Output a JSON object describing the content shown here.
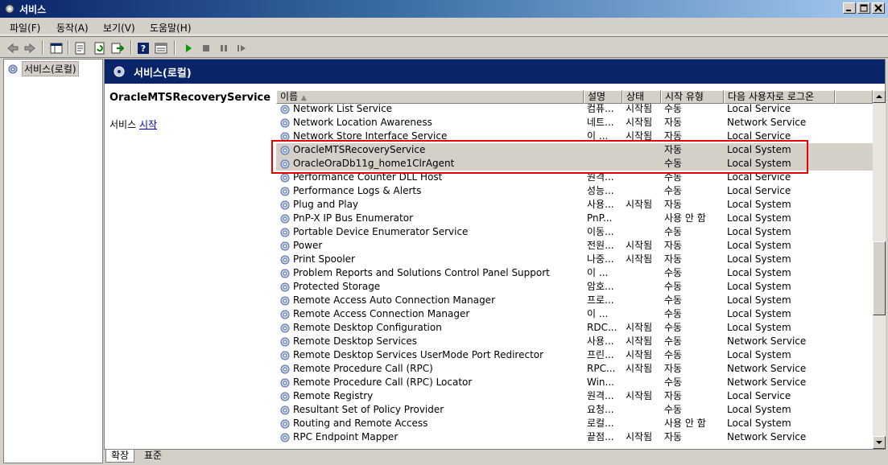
{
  "window": {
    "title": "서비스",
    "accent": "#0a246a"
  },
  "menu": [
    "파일(F)",
    "동작(A)",
    "보기(V)",
    "도움말(H)"
  ],
  "toolbar": {
    "icons": [
      "back-icon",
      "forward-icon",
      "show-hide-tree-icon",
      "properties-icon",
      "refresh-icon",
      "export-icon",
      "help-icon",
      "view-icon",
      "start-service-icon",
      "stop-service-icon",
      "pause-service-icon",
      "resume-service-icon"
    ]
  },
  "tree": {
    "root_label": "서비스(로컬)"
  },
  "pane": {
    "header": "서비스(로컬)",
    "selected_service": "OracleMTSRecoveryService",
    "action_prefix": "서비스 ",
    "action_link": "시작"
  },
  "list": {
    "columns": [
      "이름",
      "설명",
      "상태",
      "시작 유형",
      "다음 사용자로 로그온"
    ],
    "rows": [
      {
        "name": "Network List Service",
        "desc": "컴퓨...",
        "status": "시작됨",
        "startup": "수동",
        "logon": "Local Service"
      },
      {
        "name": "Network Location Awareness",
        "desc": "네트...",
        "status": "시작됨",
        "startup": "자동",
        "logon": "Network Service"
      },
      {
        "name": "Network Store Interface Service",
        "desc": "이 ...",
        "status": "시작됨",
        "startup": "자동",
        "logon": "Local Service"
      },
      {
        "name": "OracleMTSRecoveryService",
        "desc": "",
        "status": "",
        "startup": "자동",
        "logon": "Local System"
      },
      {
        "name": "OracleOraDb11g_home1ClrAgent",
        "desc": "",
        "status": "",
        "startup": "수동",
        "logon": "Local System"
      },
      {
        "name": "Performance Counter DLL Host",
        "desc": "원격...",
        "status": "",
        "startup": "수동",
        "logon": "Local Service"
      },
      {
        "name": "Performance Logs & Alerts",
        "desc": "성능...",
        "status": "",
        "startup": "수동",
        "logon": "Local Service"
      },
      {
        "name": "Plug and Play",
        "desc": "사용...",
        "status": "시작됨",
        "startup": "자동",
        "logon": "Local System"
      },
      {
        "name": "PnP-X IP Bus Enumerator",
        "desc": "PnP...",
        "status": "",
        "startup": "사용 안 함",
        "logon": "Local System"
      },
      {
        "name": "Portable Device Enumerator Service",
        "desc": "이동...",
        "status": "",
        "startup": "수동",
        "logon": "Local System"
      },
      {
        "name": "Power",
        "desc": "전원...",
        "status": "시작됨",
        "startup": "자동",
        "logon": "Local System"
      },
      {
        "name": "Print Spooler",
        "desc": "나중...",
        "status": "시작됨",
        "startup": "자동",
        "logon": "Local System"
      },
      {
        "name": "Problem Reports and Solutions Control Panel Support",
        "desc": "이 ...",
        "status": "",
        "startup": "수동",
        "logon": "Local System"
      },
      {
        "name": "Protected Storage",
        "desc": "암호...",
        "status": "",
        "startup": "수동",
        "logon": "Local System"
      },
      {
        "name": "Remote Access Auto Connection Manager",
        "desc": "프로...",
        "status": "",
        "startup": "수동",
        "logon": "Local System"
      },
      {
        "name": "Remote Access Connection Manager",
        "desc": "이 ...",
        "status": "",
        "startup": "수동",
        "logon": "Local System"
      },
      {
        "name": "Remote Desktop Configuration",
        "desc": "RDC...",
        "status": "시작됨",
        "startup": "수동",
        "logon": "Local System"
      },
      {
        "name": "Remote Desktop Services",
        "desc": "사용...",
        "status": "시작됨",
        "startup": "수동",
        "logon": "Network Service"
      },
      {
        "name": "Remote Desktop Services UserMode Port Redirector",
        "desc": "프린...",
        "status": "시작됨",
        "startup": "수동",
        "logon": "Local System"
      },
      {
        "name": "Remote Procedure Call (RPC)",
        "desc": "RPC...",
        "status": "시작됨",
        "startup": "자동",
        "logon": "Network Service"
      },
      {
        "name": "Remote Procedure Call (RPC) Locator",
        "desc": "Win...",
        "status": "",
        "startup": "수동",
        "logon": "Network Service"
      },
      {
        "name": "Remote Registry",
        "desc": "원격...",
        "status": "시작됨",
        "startup": "자동",
        "logon": "Local Service"
      },
      {
        "name": "Resultant Set of Policy Provider",
        "desc": "요청...",
        "status": "",
        "startup": "수동",
        "logon": "Local System"
      },
      {
        "name": "Routing and Remote Access",
        "desc": "로컬...",
        "status": "",
        "startup": "사용 안 함",
        "logon": "Local System"
      },
      {
        "name": "RPC Endpoint Mapper",
        "desc": "끝점...",
        "status": "시작됨",
        "startup": "자동",
        "logon": "Network Service"
      }
    ]
  },
  "tabs": [
    "확장",
    "표준"
  ]
}
